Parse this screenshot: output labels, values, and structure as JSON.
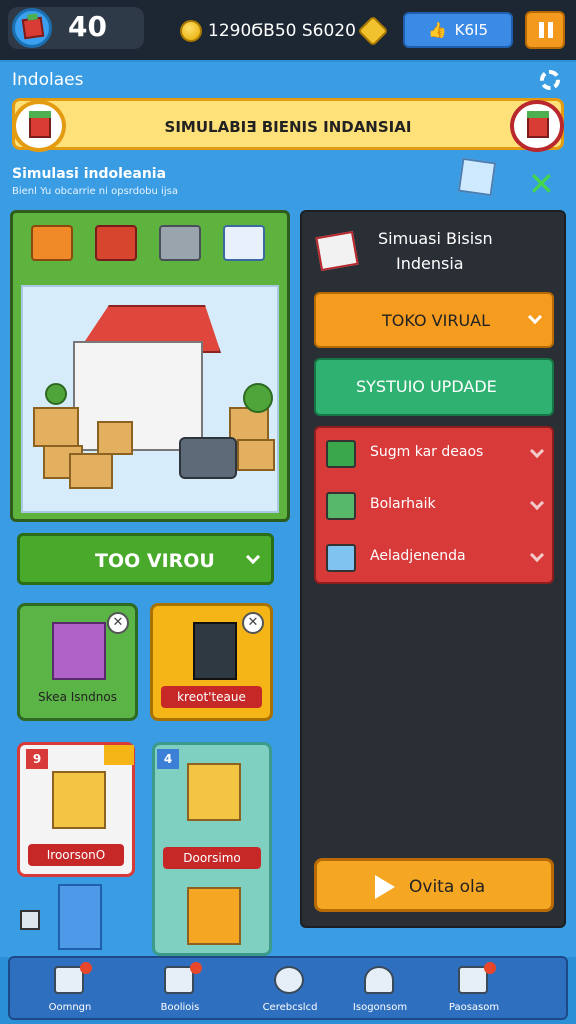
{
  "topbar": {
    "level": "40",
    "currency_text": "1290ϬB50 S6020",
    "share_label": "K6I5"
  },
  "panel": {
    "title": "Indolaes",
    "banner_title": "SIMULABIƎ BIENIS INDANSIAI",
    "subtitle": "Simulasi indoleania",
    "subtitle_small": "Bienl Yu obcarrie ni opsrdobu ijsa"
  },
  "left": {
    "dropdown_label": "TOO VIROU",
    "cards": [
      {
        "label": "Skea Isndnos",
        "color": "green"
      },
      {
        "label": "kreot'teaue",
        "color": "orange"
      },
      {
        "label": "IroorsonO",
        "badge": "9",
        "color": "white"
      },
      {
        "label": "Doorsimo",
        "badge": "4",
        "color": "teal"
      }
    ]
  },
  "right": {
    "title_line1": "Simuasi Bisisn",
    "title_line2": "Indensia",
    "dropdown1": "TOKO VIRUAL",
    "dropdown2": "SYSTUIO UPDADE",
    "list": [
      {
        "label": "Sugm kar deaos",
        "icon": "cash-register-icon"
      },
      {
        "label": "Bolarhaik",
        "icon": "crate-icon"
      },
      {
        "label": "Aeladjenenda",
        "icon": "box-open-icon"
      }
    ],
    "cta": "Ovita ola"
  },
  "nav": [
    {
      "label": "Oomngn",
      "icon": "dashboard-icon"
    },
    {
      "label": "Booliois",
      "icon": "book-icon"
    },
    {
      "label": "Cerebcslcd",
      "icon": "gauge-icon"
    },
    {
      "label": "Isogonsom",
      "icon": "user-icon"
    },
    {
      "label": "Paosasom",
      "icon": "camera-icon"
    }
  ],
  "colors": {
    "accent_orange": "#f59c1f",
    "accent_green": "#49a92a",
    "accent_red": "#d83a3a",
    "panel_blue": "#3a9de4",
    "dark": "#2a2f36"
  }
}
